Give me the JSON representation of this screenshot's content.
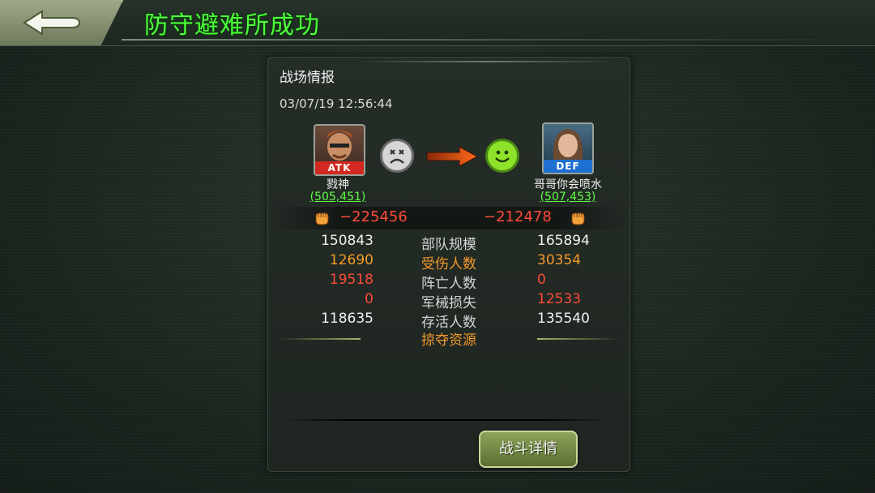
{
  "header": {
    "title": "防守避难所成功",
    "back_icon": "back-arrow-icon"
  },
  "report": {
    "title": "战场情报",
    "timestamp": "03/07/19  12:56:44"
  },
  "attacker": {
    "tag": "ATK",
    "name": "戮神",
    "power": "(505,451)",
    "loss": "−225456",
    "status_icon": "sad-face-icon"
  },
  "defender": {
    "tag": "DEF",
    "name": "哥哥你会喷水",
    "power": "(507,453)",
    "loss": "−212478",
    "status_icon": "happy-face-icon"
  },
  "stats": [
    {
      "label": "部队规模",
      "atk": "150843",
      "def": "165894"
    },
    {
      "label": "受伤人数",
      "atk": "12690",
      "def": "30354"
    },
    {
      "label": "阵亡人数",
      "atk": "19518",
      "def": "0"
    },
    {
      "label": "军械损失",
      "atk": "0",
      "def": "12533"
    },
    {
      "label": "存活人数",
      "atk": "118635",
      "def": "135540"
    }
  ],
  "plunder_label": "掠夺资源",
  "detail_button": "战斗详情",
  "colors": {
    "title_green": "#4cff3a",
    "power_green": "#5dff45",
    "loss_red": "#ff4a3a",
    "orange": "#f39a2a"
  }
}
